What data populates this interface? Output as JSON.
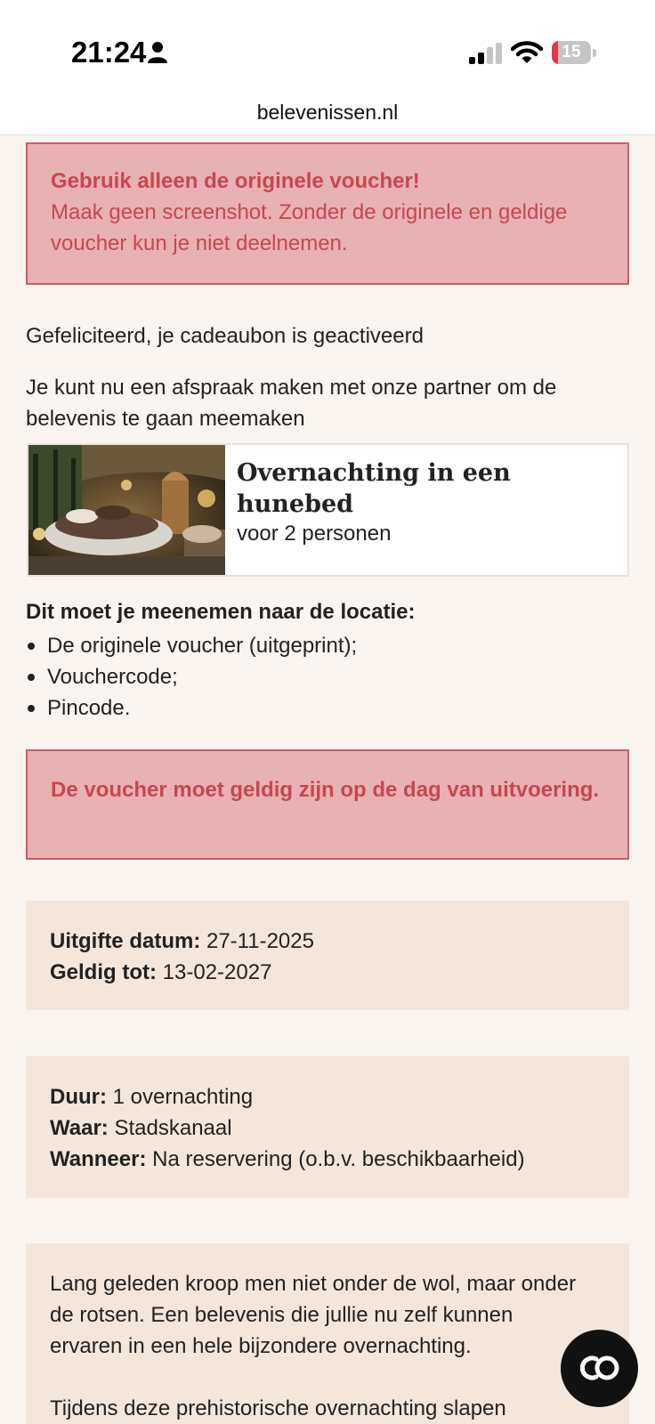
{
  "status": {
    "time": "21:24",
    "battery_level": "15",
    "icons": [
      "person-icon",
      "signal-icon",
      "wifi-icon",
      "battery-icon"
    ]
  },
  "browser": {
    "url": "belevenissen.nl"
  },
  "alert_top": {
    "heading": "Gebruik alleen de originele voucher!",
    "body": "Maak geen screenshot. Zonder de originele en geldige voucher kun je niet deelnemen."
  },
  "congrats": "Gefeliciteerd, je cadeaubon is geactiveerd",
  "instruction": "Je kunt nu een afspraak maken met onze partner om de belevenis te gaan meemaken",
  "product": {
    "title": "Overnachting in een hunebed",
    "subtitle": "voor 2 personen"
  },
  "bring": {
    "title": "Dit moet je meenemen naar de locatie:",
    "items": [
      "De originele voucher (uitgeprint);",
      "Vouchercode;",
      "Pincode."
    ]
  },
  "alert_bottom": "De voucher moet geldig zijn op de dag van uitvoering.",
  "dates": {
    "issue_label": "Uitgifte datum:",
    "issue_value": "27-11-2025",
    "valid_label": "Geldig tot:",
    "valid_value": "13-02-2027"
  },
  "details": {
    "duration_label": "Duur:",
    "duration_value": "1 overnachting",
    "where_label": "Waar:",
    "where_value": "Stadskanaal",
    "when_label": "Wanneer:",
    "when_value": "Na reservering (o.b.v. beschikbaarheid)"
  },
  "description": {
    "p1": "Lang geleden kroop men niet onder de wol, maar onder de rotsen. Een belevenis die jullie nu zelf kunnen ervaren in een hele bijzondere overnachting.",
    "p2": "Tijdens deze prehistorische overnachting slapen"
  },
  "colors": {
    "alert_bg": "#e8b1b3",
    "alert_border": "#d45864",
    "alert_text": "#c8474f",
    "info_bg": "#f4e6db",
    "page_bg": "#faf5f1"
  }
}
